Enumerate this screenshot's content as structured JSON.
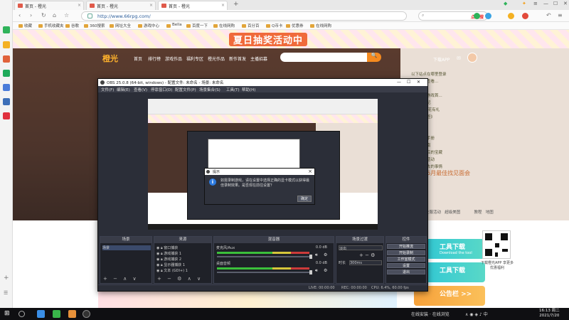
{
  "browser": {
    "tabs": [
      {
        "title": "首页 - 橙光"
      },
      {
        "title": "首页 - 橙光"
      },
      {
        "title": "首页 - 橙光"
      }
    ],
    "url": "http://www.66rpg.com/",
    "search_hot": "点击搜",
    "bookmarks": [
      "收藏",
      "手机收藏夹",
      "谷歌",
      "360搜索",
      "网址大全",
      "游戏中心",
      "Bella",
      "百度一下",
      "在线网购",
      "百分百",
      "Q币卡",
      "优惠券",
      "在线网购"
    ]
  },
  "site": {
    "promo_title": "夏日抽奖活动中",
    "logo": "橙光",
    "nav": [
      "首页",
      "排行榜",
      "游戏作品",
      "福利专区",
      "橙光作品",
      "新作首发",
      "主播招募"
    ],
    "search_button": "🔍",
    "download_app": "下载APP",
    "side_list": [
      "以下站点在哪里登录",
      "登录后的查看...",
      "花花公主",
      "古代网络游戏首...",
      "王爷的毒妃",
      "第九区·花花有礼",
      "《夏日抽签》",
      "全部游戏",
      "金手指",
      "千金成长手册",
      "排行总指南",
      "女主角最后的宝藏",
      "橙光平台活动",
      "梦到你过去的事情"
    ],
    "side_big": "6月最佳找见面会",
    "tags": [
      "全服活动",
      "超级美图",
      "教程",
      "地图"
    ],
    "cards": [
      {
        "title": "工具下载",
        "sub": "Download the tool"
      },
      {
        "title": "工具下载",
        "sub": ""
      },
      {
        "title": "公告栏 >>",
        "sub": ""
      }
    ],
    "qr_caption": "下载橙光APP 享更多优惠福利"
  },
  "obs": {
    "title": "OBS 25.0.8 (64-bit, windows) - 配置文件: 未命名 - 场景: 未命名",
    "menu": [
      "文件(F)",
      "编辑(E)",
      "查看(V)",
      "停靠窗口(D)",
      "配置文件(P)",
      "场景集合(S)",
      "工具(T)",
      "帮助(H)"
    ],
    "dialog": {
      "title": "提示",
      "message": "如需录制游戏，请在设置中选择正确的显卡模式以获得最佳录制效果。是否现在前往设置？",
      "ok": "确定"
    },
    "docks": {
      "scenes": {
        "title": "场景",
        "items": [
          "场景"
        ]
      },
      "sources": {
        "title": "来源",
        "items": [
          "窗口捕获",
          "游戏捕获 1",
          "游戏捕获 2",
          "显示器捕获 1",
          "文本 (GDI+) 1"
        ]
      },
      "mixer": {
        "title": "混音器",
        "tracks": [
          {
            "name": "麦克风/Aux",
            "db": "0.0 dB"
          },
          {
            "name": "桌面音频",
            "db": "0.0 dB"
          }
        ]
      },
      "transitions": {
        "title": "场景过渡",
        "type": "淡出",
        "duration_label": "时长",
        "duration": "300ms"
      },
      "controls": {
        "title": "控件",
        "buttons": [
          "开始推流",
          "开始录制",
          "工作室模式",
          "设置",
          "退出"
        ]
      }
    },
    "status": {
      "live": "LIVE: 00:00:00",
      "rec": "REC: 00:00:00",
      "cpu": "CPU: 6.4%, 60.00 fps"
    }
  },
  "taskbar": {
    "tray_text": "在线安装 · 在线浏览",
    "time": "16:13 周二",
    "date": "2021/7/20"
  }
}
